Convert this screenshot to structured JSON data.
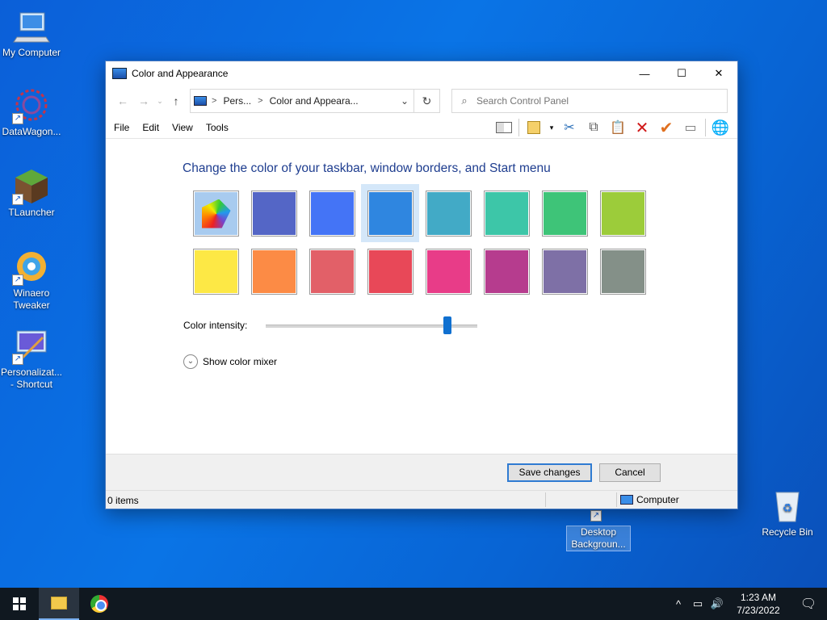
{
  "desktop": {
    "icons": [
      {
        "label": "My Computer"
      },
      {
        "label": "DataWagon..."
      },
      {
        "label": "TLauncher"
      },
      {
        "label": "Winaero Tweaker"
      },
      {
        "label": "Personalizat... - Shortcut"
      },
      {
        "label": "Desktop Backgroun..."
      },
      {
        "label": "Recycle Bin"
      }
    ]
  },
  "window": {
    "title": "Color and Appearance",
    "controls": {
      "minimize": "—",
      "maximize": "☐",
      "close": "✕"
    },
    "address": {
      "crumbs": [
        "Pers...",
        "Color and Appeara..."
      ],
      "separator": ">"
    },
    "search": {
      "placeholder": "Search Control Panel"
    },
    "menu": [
      "File",
      "Edit",
      "View",
      "Tools"
    ],
    "toolbar_icons": [
      "preview-pane-icon",
      "views-icon",
      "cut-icon",
      "copy-icon",
      "paste-icon",
      "delete-icon",
      "apply-icon",
      "properties-icon",
      "globe-icon"
    ],
    "heading": "Change the color of your taskbar, window borders, and Start menu",
    "swatches": [
      {
        "color": "palette",
        "selected": false
      },
      {
        "color": "#5466c6",
        "selected": false
      },
      {
        "color": "#4474f6",
        "selected": false
      },
      {
        "color": "#2f86e0",
        "selected": true
      },
      {
        "color": "#42aac6",
        "selected": false
      },
      {
        "color": "#3dc6a8",
        "selected": false
      },
      {
        "color": "#3ec478",
        "selected": false
      },
      {
        "color": "#9ccc3a",
        "selected": false
      },
      {
        "color": "#fde845",
        "selected": false
      },
      {
        "color": "#fc8b45",
        "selected": false
      },
      {
        "color": "#e26068",
        "selected": false
      },
      {
        "color": "#e84858",
        "selected": false
      },
      {
        "color": "#e83c88",
        "selected": false
      },
      {
        "color": "#b63c8e",
        "selected": false
      },
      {
        "color": "#7e70a6",
        "selected": false
      },
      {
        "color": "#849088",
        "selected": false
      }
    ],
    "intensity": {
      "label": "Color intensity:",
      "value": 0.86
    },
    "mixer_label": "Show color mixer",
    "buttons": {
      "save": "Save changes",
      "cancel": "Cancel"
    },
    "status": {
      "items": "0 items",
      "location": "Computer"
    }
  },
  "taskbar": {
    "time": "1:23 AM",
    "date": "7/23/2022",
    "tray": {
      "chevron": "^",
      "network": "▭",
      "volume": "🔊",
      "notifications": "🗨"
    }
  }
}
